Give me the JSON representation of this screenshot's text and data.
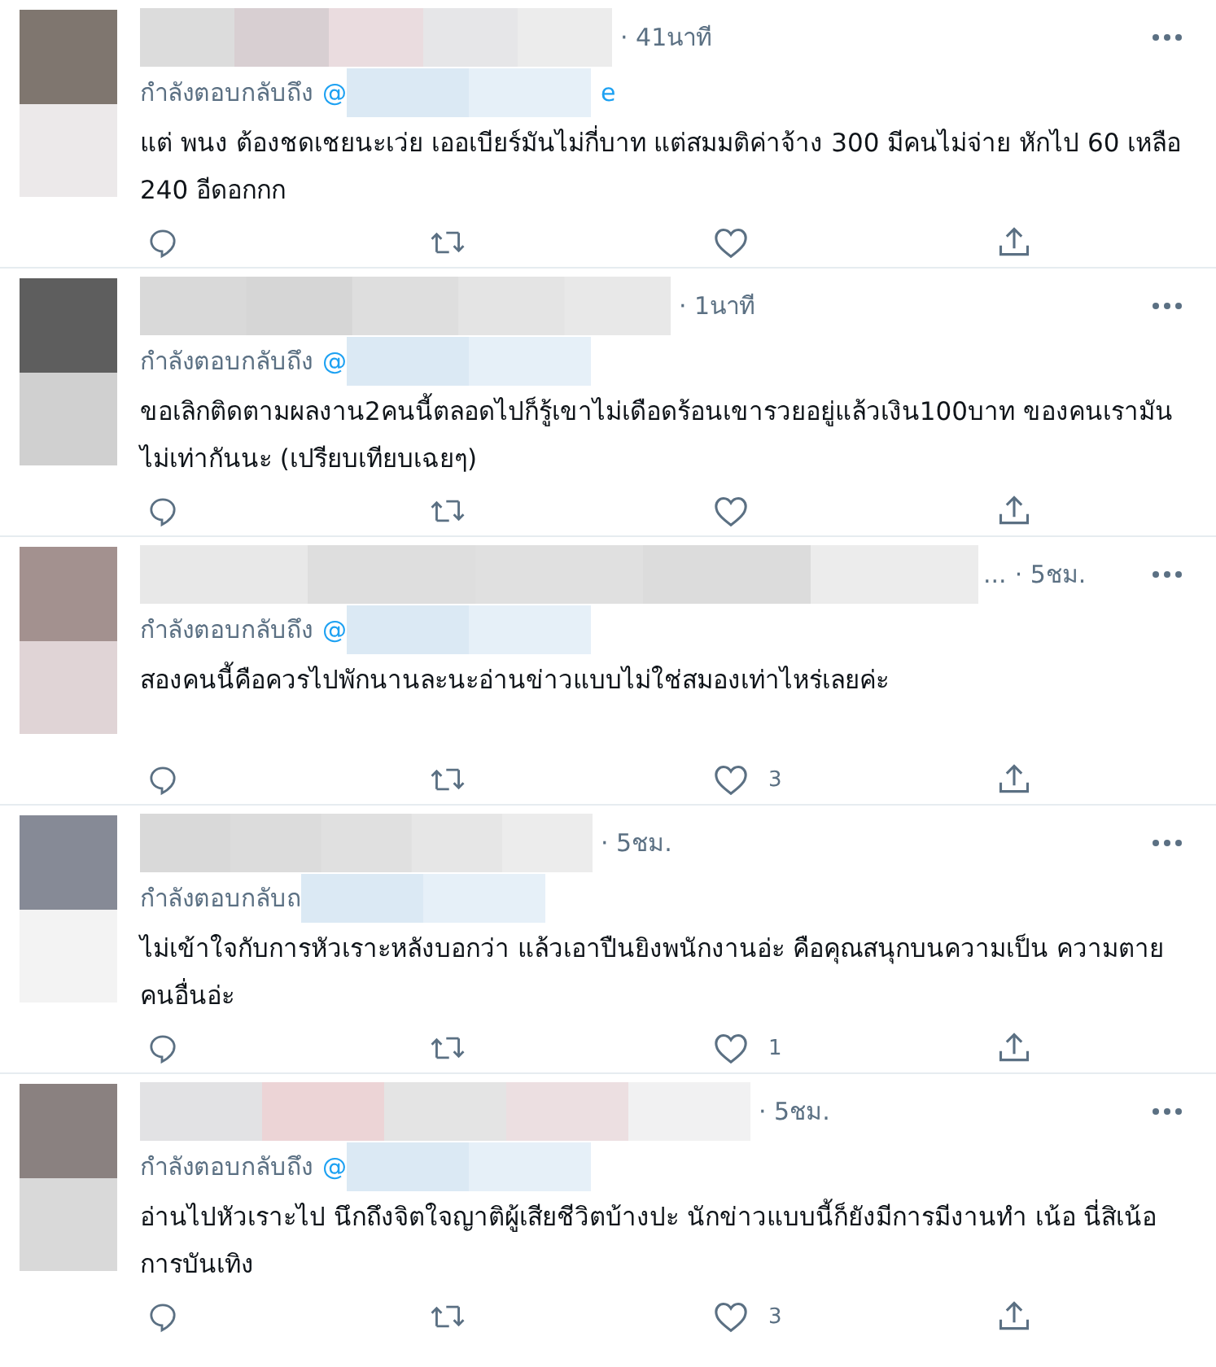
{
  "tweets": [
    {
      "time": "· 41นาที",
      "reply_prefix": "กำลังตอบกลับถึง",
      "mention": "@",
      "mention_tail": "e",
      "text": "แต่ พนง ต้องชดเชยนะเว่ย เออเบียร์มันไม่กี่บาท แต่สมมติค่าจ้าง 300 มีคนไม่จ่าย หักไป 60 เหลือ 240 อีดอกกก"
    },
    {
      "time": "· 1นาที",
      "reply_prefix": "กำลังตอบกลับถึง",
      "mention": "@",
      "text": "ขอเลิกติดตามผลงาน2คนนี้ตลอดไปก็รู้เขาไม่เดือดร้อนเขารวยอยู่แล้วเงิน100บาท ของคนเรามันไม่เท่ากันนะ (เปรียบเทียบเฉยๆ)"
    },
    {
      "name_tail": "...",
      "time": "· 5ชม.",
      "reply_prefix": "กำลังตอบกลับถึง",
      "mention": "@",
      "text": "สองคนนี้คือควรไปพักนานละนะอ่านข่าวแบบไม่ใช่สมองเท่าไหร่เลยค่ะ",
      "likes": "3"
    },
    {
      "time": "· 5ชม.",
      "reply_prefix": "กำลังตอบกลับถ",
      "text": "ไม่เข้าใจกับการหัวเราะหลังบอกว่า แล้วเอาปืนยิงพนักงานอ่ะ คือคุณสนุกบนความเป็น ความตายคนอื่นอ่ะ",
      "likes": "1"
    },
    {
      "time": "· 5ชม.",
      "reply_prefix": "กำลังตอบกลับถึง",
      "mention": "@",
      "text": "อ่านไปหัวเราะไป นึกถึงจิตใจญาติผู้เสียชีวิตบ้างปะ นักข่าวแบบนี้ก็ยังมีการมีงานทำ เน้อ นี่สิเน้อ การบันเทิง",
      "likes": "3"
    }
  ]
}
